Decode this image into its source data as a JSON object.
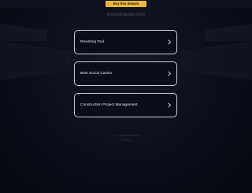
{
  "top_bar": {
    "buy_label": "Buy this domain",
    "button_color": "#e8b83a"
  },
  "domain": "projectnoplan.com",
  "related_links": [
    {
      "label": "Rewriting Tool",
      "icon": "chevron-right-icon"
    },
    {
      "label": "Best Social Casino",
      "icon": "chevron-right-icon"
    },
    {
      "label": "Construction Project Management",
      "icon": "chevron-right-icon"
    }
  ],
  "footer": {
    "line1": "© projectnoplan.com",
    "line2": "Privacy"
  }
}
